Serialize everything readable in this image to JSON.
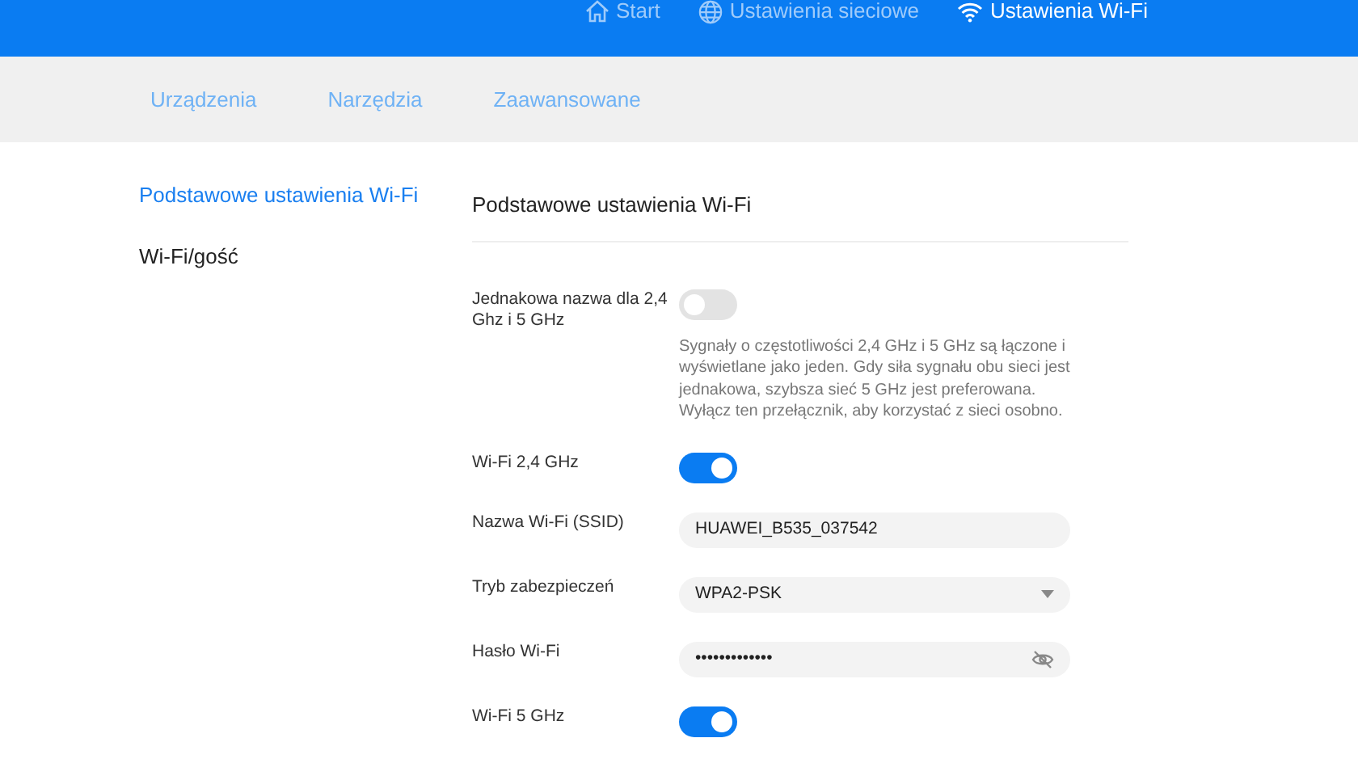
{
  "top_nav": [
    {
      "kind": "home",
      "label": "Start",
      "selected": false
    },
    {
      "kind": "globe",
      "label": "Ustawienia sieciowe",
      "selected": false
    },
    {
      "kind": "wifi",
      "label": "Ustawienia Wi-Fi",
      "selected": true
    }
  ],
  "sub_nav": [
    {
      "label": "Urządzenia"
    },
    {
      "label": "Narzędzia"
    },
    {
      "label": "Zaawansowane"
    }
  ],
  "sidebar": {
    "items": [
      {
        "label": "Podstawowe ustawienia Wi-Fi",
        "selected": true
      },
      {
        "label": "Wi-Fi/gość",
        "selected": false
      }
    ]
  },
  "section": {
    "title": "Podstawowe ustawienia Wi-Fi",
    "rows": [
      {
        "kind": "toggle",
        "label": "Jednakowa nazwa dla 2,4 Ghz i 5 GHz",
        "on": false,
        "description": "Sygnały o częstotliwości 2,4 GHz i 5 GHz są łączone i wyświetlane jako jeden. Gdy siła sygnału obu sieci jest jednakowa, szybsza sieć 5 GHz jest preferowana. Wyłącz ten przełącznik, aby korzystać z sieci osobno."
      },
      {
        "kind": "toggle",
        "label": "Wi-Fi 2,4 GHz",
        "on": true
      },
      {
        "kind": "text",
        "label": "Nazwa Wi-Fi (SSID)",
        "value": "HUAWEI_B535_037542"
      },
      {
        "kind": "select",
        "label": "Tryb zabezpieczeń",
        "value": "WPA2-PSK"
      },
      {
        "kind": "password",
        "label": "Hasło Wi-Fi",
        "value": "•••••••••••••"
      },
      {
        "kind": "toggle",
        "label": "Wi-Fi 5 GHz",
        "on": true
      }
    ]
  }
}
